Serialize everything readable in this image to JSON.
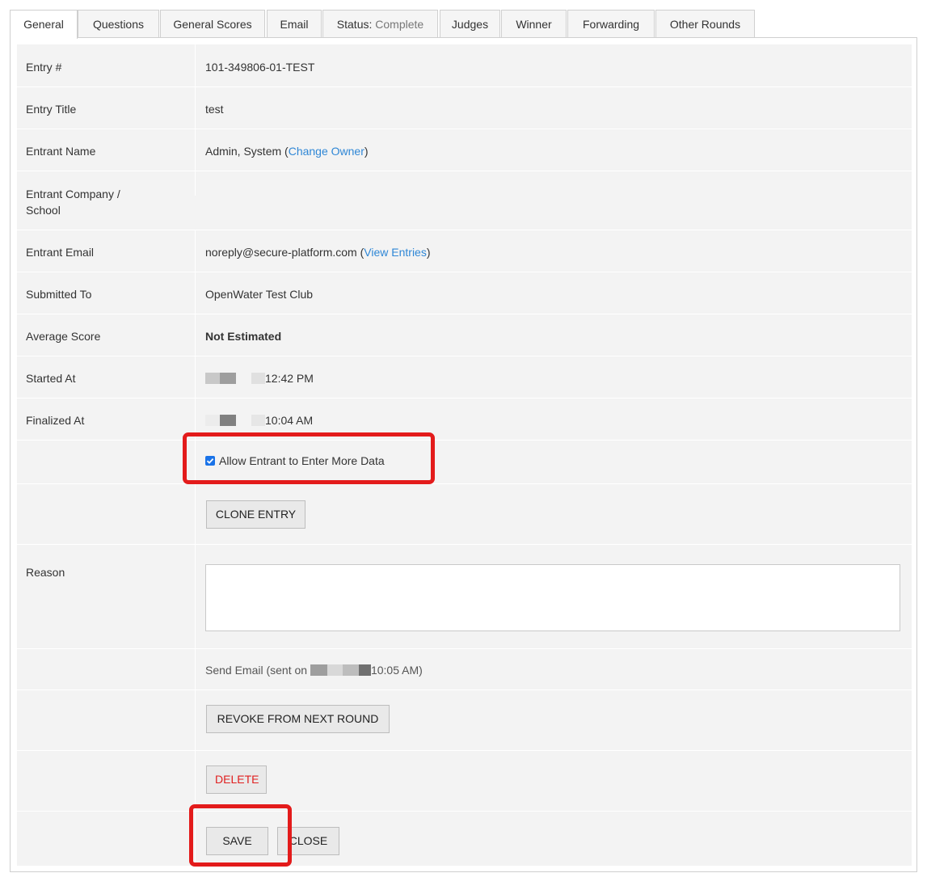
{
  "tabs": [
    {
      "label": "General"
    },
    {
      "label": "Questions"
    },
    {
      "label": "General Scores"
    },
    {
      "label": "Email"
    },
    {
      "label": "Status:",
      "value": "Complete"
    },
    {
      "label": "Judges"
    },
    {
      "label": "Winner"
    },
    {
      "label": "Forwarding"
    },
    {
      "label": "Other Rounds"
    }
  ],
  "fields": {
    "entry_number": {
      "label": "Entry #",
      "value": "101-349806-01-TEST"
    },
    "entry_title": {
      "label": "Entry Title",
      "value": "test"
    },
    "entrant_name": {
      "label": "Entrant Name",
      "value": "Admin, System (",
      "link": "Change Owner",
      "suffix": ")"
    },
    "entrant_company": {
      "label": "Entrant Company / School",
      "value": ""
    },
    "entrant_email": {
      "label": "Entrant Email",
      "value": "noreply@secure-platform.com (",
      "link": "View Entries",
      "suffix": ")"
    },
    "submitted_to": {
      "label": "Submitted To",
      "value": "OpenWater Test Club"
    },
    "average_score": {
      "label": "Average Score",
      "value": "Not Estimated"
    },
    "started_at": {
      "label": "Started At",
      "value": "12:42 PM"
    },
    "finalized_at": {
      "label": "Finalized At",
      "value": "10:04 AM"
    }
  },
  "allow_more_data": {
    "label": "Allow Entrant to Enter More Data",
    "checked": true
  },
  "clone_button": "CLONE ENTRY",
  "reason": {
    "label": "Reason",
    "value": ""
  },
  "send_email": {
    "prefix": "Send Email (sent on ",
    "time": "10:05 AM)"
  },
  "revoke_button": "REVOKE FROM NEXT ROUND",
  "delete_button": "DELETE",
  "save_button": "SAVE",
  "close_button": "CLOSE",
  "colors": {
    "link": "#2f87d6",
    "danger": "#e02020",
    "highlight": "#e31b1b",
    "checkbox": "#1a73e8"
  }
}
